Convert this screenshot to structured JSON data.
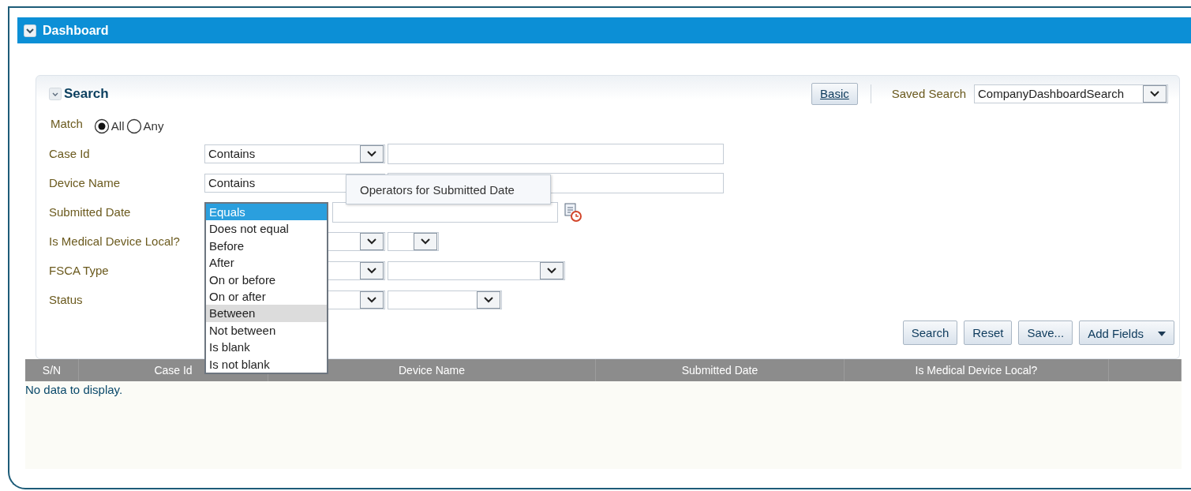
{
  "panel": {
    "title": "Dashboard",
    "expanded": true
  },
  "search": {
    "title": "Search",
    "expanded": true,
    "mode_button": "Basic",
    "saved_search_label": "Saved Search",
    "saved_search_value": "CompanyDashboardSearch",
    "match": {
      "label": "Match",
      "options": [
        {
          "label": "All",
          "selected": true
        },
        {
          "label": "Any",
          "selected": false
        }
      ]
    },
    "fields": [
      {
        "label": "Case Id",
        "kind": "text",
        "operator": "Contains"
      },
      {
        "label": "Device Name",
        "kind": "text",
        "operator": "Contains"
      },
      {
        "label": "Submitted Date",
        "kind": "date"
      },
      {
        "label": "Is Medical Device Local?",
        "kind": "choice"
      },
      {
        "label": "FSCA Type",
        "kind": "choice"
      },
      {
        "label": "Status",
        "kind": "choice"
      }
    ],
    "operator_list": {
      "tooltip": "Operators for Submitted Date",
      "options": [
        {
          "label": "Equals",
          "selected": true,
          "highlighted": false
        },
        {
          "label": "Does not equal",
          "selected": false,
          "highlighted": false
        },
        {
          "label": "Before",
          "selected": false,
          "highlighted": false
        },
        {
          "label": "After",
          "selected": false,
          "highlighted": false
        },
        {
          "label": "On or before",
          "selected": false,
          "highlighted": false
        },
        {
          "label": "On or after",
          "selected": false,
          "highlighted": false
        },
        {
          "label": "Between",
          "selected": false,
          "highlighted": true
        },
        {
          "label": "Not between",
          "selected": false,
          "highlighted": false
        },
        {
          "label": "Is blank",
          "selected": false,
          "highlighted": false
        },
        {
          "label": "Is not blank",
          "selected": false,
          "highlighted": false
        }
      ]
    },
    "buttons": [
      "Search",
      "Reset",
      "Save..."
    ],
    "add_fields": "Add Fields"
  },
  "table": {
    "columns": [
      "S/N",
      "Case Id",
      "Device Name",
      "Submitted Date",
      "Is Medical Device Local?"
    ],
    "empty_message": "No data to display."
  }
}
